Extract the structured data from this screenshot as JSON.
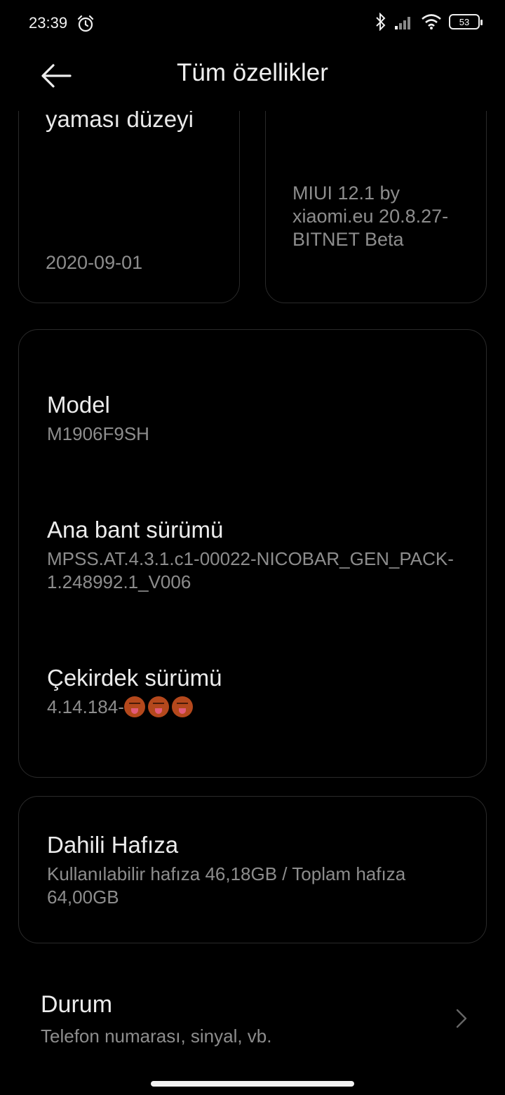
{
  "status_bar": {
    "time": "23:39",
    "battery_level": "53",
    "icons": [
      "alarm-icon",
      "bluetooth-icon",
      "signal-icon",
      "wifi-icon",
      "battery-icon"
    ]
  },
  "header": {
    "title": "Tüm özellikler"
  },
  "cards_top": {
    "security_patch": {
      "heading_partial": "yaması düzeyi",
      "value": "2020-09-01"
    },
    "miui_version": {
      "value": "MIUI 12.1 by xiaomi.eu 20.8.27-BITNET Beta"
    }
  },
  "device_info": {
    "model": {
      "label": "Model",
      "value": "M1906F9SH"
    },
    "baseband": {
      "label": "Ana bant sürümü",
      "value": "MPSS.AT.4.3.1.c1-00022-NICOBAR_GEN_PACK-1.248992.1_V006"
    },
    "kernel": {
      "label": "Çekirdek sürümü",
      "value": "4.14.184-",
      "emoji_count": 3
    }
  },
  "storage": {
    "label": "Dahili Hafıza",
    "value": "Kullanılabilir hafıza 46,18GB / Toplam hafıza 64,00GB"
  },
  "status": {
    "label": "Durum",
    "sub": "Telefon numarası, sinyal, vb."
  },
  "colors": {
    "background": "#000000",
    "primary_text": "#ececec",
    "secondary_text": "#8d8d8d",
    "card_border": "#2a2a2a"
  }
}
